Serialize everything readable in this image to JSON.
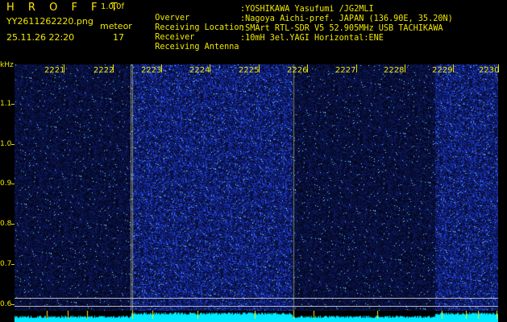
{
  "header": {
    "brand": "H R O F F T",
    "version": "1.0.0f",
    "filename": "YY2611262220.png",
    "timestamp": "25.11.26 22:20",
    "meteor_label": "meteor",
    "meteor_count": "17",
    "info": [
      {
        "label": "Overver",
        "value": ":YOSHIKAWA Yasufumi /JG2MLI"
      },
      {
        "label": "Receiving Location",
        "value": ":Nagoya Aichi-pref. JAPAN (136.90E, 35.20N)"
      },
      {
        "label": "Receiver",
        "value": ":SMArt RTL-SDR V5 52.905MHz USB TACHIKAWA"
      },
      {
        "label": "Receiving Antenna",
        "value": ":10mH 3el.YAGI Horizontal:ENE"
      }
    ]
  },
  "y_axis": {
    "unit": "kHz",
    "ticks": [
      "1.1",
      "1.0",
      "0.9",
      "0.8",
      "0.7",
      "0.6"
    ]
  },
  "time_axis": {
    "labels": [
      "2221",
      "2222",
      "2223",
      "2224",
      "2225",
      "2226",
      "2227",
      "2228",
      "2229",
      "2230"
    ]
  },
  "colors": {
    "text": "#f0e800",
    "background": "#000000",
    "spectrum": "#00e8ff"
  }
}
